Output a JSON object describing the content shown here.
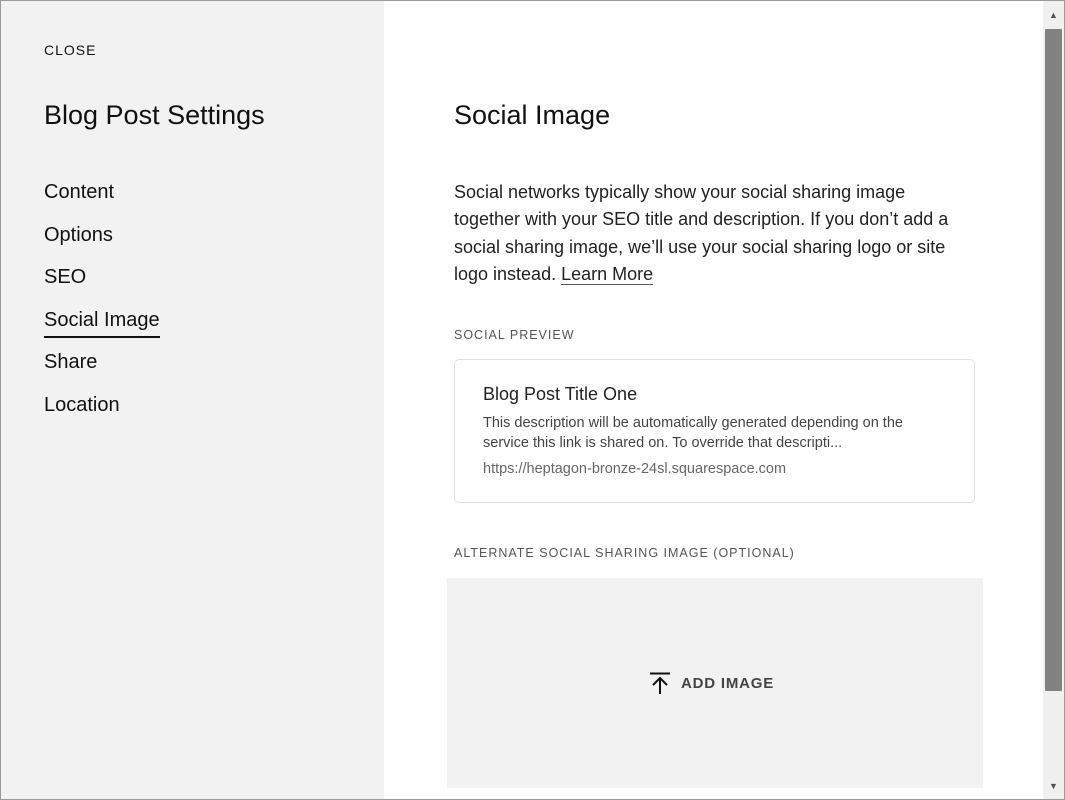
{
  "sidebar": {
    "close_label": "CLOSE",
    "title": "Blog Post Settings",
    "items": [
      {
        "label": "Content"
      },
      {
        "label": "Options"
      },
      {
        "label": "SEO"
      },
      {
        "label": "Social Image",
        "active": true
      },
      {
        "label": "Share"
      },
      {
        "label": "Location"
      }
    ]
  },
  "main": {
    "title": "Social Image",
    "description": "Social networks typically show your social sharing image together with your SEO title and description. If you don’t add a social sharing image, we’ll use your social sharing logo or site logo instead.",
    "learn_more": "Learn More",
    "social_preview": {
      "label": "SOCIAL PREVIEW",
      "title": "Blog Post Title One",
      "description": "This description will be automatically generated depending on the service this link is shared on. To override that descripti...",
      "url": "https://heptagon-bronze-24sl.squarespace.com"
    },
    "alternate_image": {
      "label": "ALTERNATE SOCIAL SHARING IMAGE (OPTIONAL)",
      "add_label": "ADD IMAGE",
      "icon": "upload-icon"
    }
  },
  "scrollbar": {
    "up_icon": "▲",
    "down_icon": "▼"
  },
  "colors": {
    "sidebar_bg": "#f2f2f2",
    "dropzone_bg": "#f2f2f2",
    "text": "#111111",
    "scrollbar_thumb": "#828282"
  }
}
